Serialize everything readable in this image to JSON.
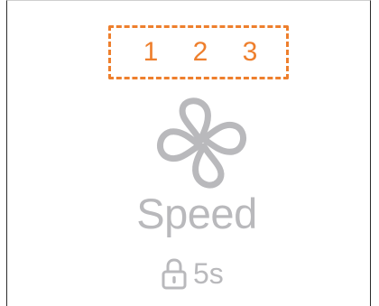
{
  "speed_selector": {
    "options": [
      "1",
      "2",
      "3"
    ],
    "highlight_color": "#ee7f2d"
  },
  "fan": {
    "icon": "fan-icon",
    "color": "#b9b9bc"
  },
  "mode": {
    "label": "Speed"
  },
  "lock": {
    "icon": "lock-icon",
    "countdown": "5s"
  }
}
